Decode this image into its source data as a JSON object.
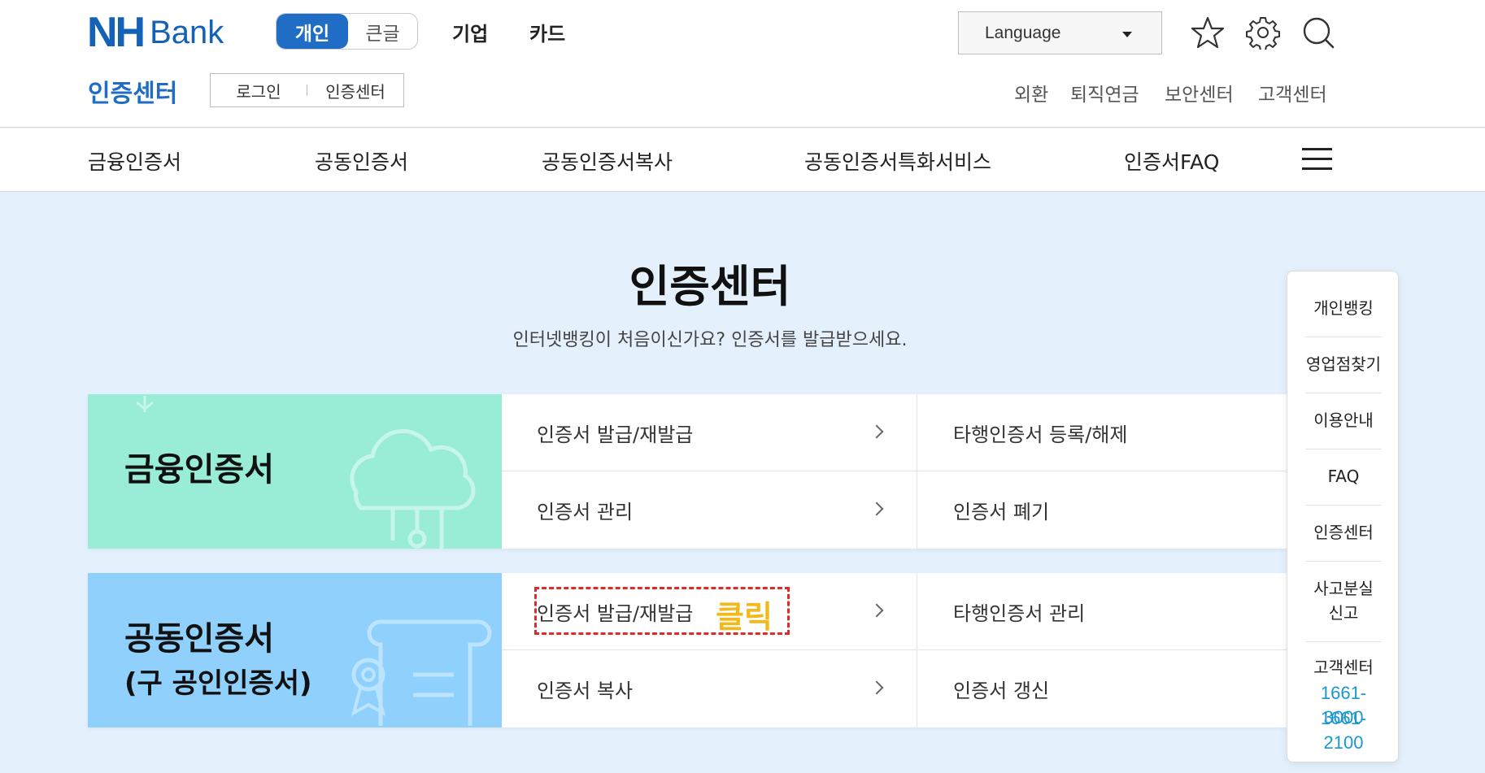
{
  "header": {
    "logo": {
      "nh": "NH",
      "bank": "Bank"
    },
    "toggle": {
      "active": "개인",
      "inactive": "큰글"
    },
    "top_links": [
      "기업",
      "카드"
    ],
    "language": "Language",
    "icons": [
      "star-icon",
      "gear-icon",
      "search-icon"
    ],
    "sub_title": "인증센터",
    "sub_tabs": [
      "로그인",
      "인증센터"
    ],
    "util_links": [
      "외환",
      "퇴직연금",
      "보안센터",
      "고객센터"
    ]
  },
  "gnb": {
    "items": [
      "금융인증서",
      "공동인증서",
      "공동인증서복사",
      "공동인증서특화서비스",
      "인증서FAQ"
    ]
  },
  "main": {
    "title": "인증센터",
    "desc": "인터넷뱅킹이 처음이신가요? 인증서를 발급받으세요."
  },
  "cards": [
    {
      "title": "금융인증서",
      "subtitle": "",
      "left": [
        "인증서 발급/재발급",
        "인증서 관리"
      ],
      "right": [
        "타행인증서 등록/해제",
        "인증서 폐기"
      ]
    },
    {
      "title": "공동인증서",
      "subtitle": "(구 공인인증서)",
      "left": [
        "인증서 발급/재발급",
        "인증서 복사"
      ],
      "right": [
        "타행인증서 관리",
        "인증서 갱신"
      ]
    }
  ],
  "annotation": {
    "label": "클릭"
  },
  "quick_menu": {
    "items": [
      "개인뱅킹",
      "영업점찾기",
      "이용안내",
      "FAQ",
      "인증센터",
      "사고분실",
      "신고",
      "고객센터"
    ],
    "phones": [
      "1661-3000",
      "1661-2100"
    ]
  },
  "colors": {
    "brand_blue": "#1462b8",
    "financial_card": "#99ecd6",
    "joint_card": "#8fd0fc",
    "page_bg": "#e4f1fd",
    "annotation_red": "#e02a2a",
    "annotation_yellow": "#f3b81a",
    "phone": "#1a97d3"
  }
}
